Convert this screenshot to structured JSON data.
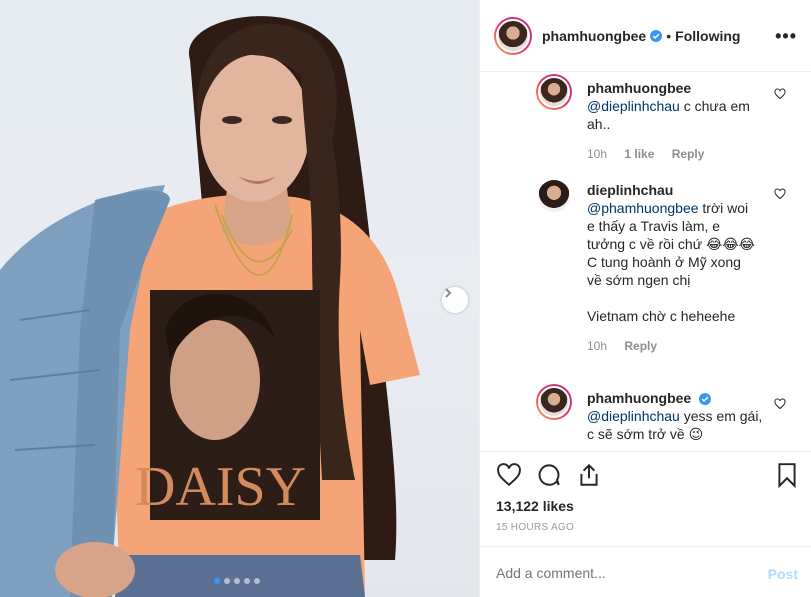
{
  "post": {
    "dots_count": 5,
    "active_dot": 1
  },
  "header": {
    "username": "phamhuongbee",
    "separator": "•",
    "following_label": "Following",
    "more_icon": "more-horizontal-icon"
  },
  "comments": [
    {
      "username": "phamhuongbee",
      "verified": false,
      "mention": "@dieplinhchau",
      "text": " c chưa em ah..",
      "time": "10h",
      "likes": "1 like",
      "reply": "Reply"
    },
    {
      "username": "dieplinhchau",
      "mention": "@phamhuongbee",
      "text": " trời woi e thấy a Travis làm, e tưởng c về rồi chứ 😂😂😂",
      "line2": "C tung hoành ở Mỹ xong về sớm ngen chị",
      "line3": "Vietnam chờ c heheehe",
      "time": "10h",
      "reply": "Reply"
    },
    {
      "username": "phamhuongbee",
      "verified": true,
      "mention": "@dieplinhchau",
      "text": " yess em gái, c sẽ sớm trở về 😉"
    }
  ],
  "actions": {
    "likes": "13,122 likes",
    "posted": "15 HOURS AGO"
  },
  "add_comment": {
    "placeholder": "Add a comment...",
    "post_label": "Post"
  },
  "colors": {
    "accent": "#3897f0",
    "mention": "#003569",
    "post_disabled": "#b3dbff",
    "shirt": "#f4a477",
    "denim": "#7f9fbf"
  }
}
